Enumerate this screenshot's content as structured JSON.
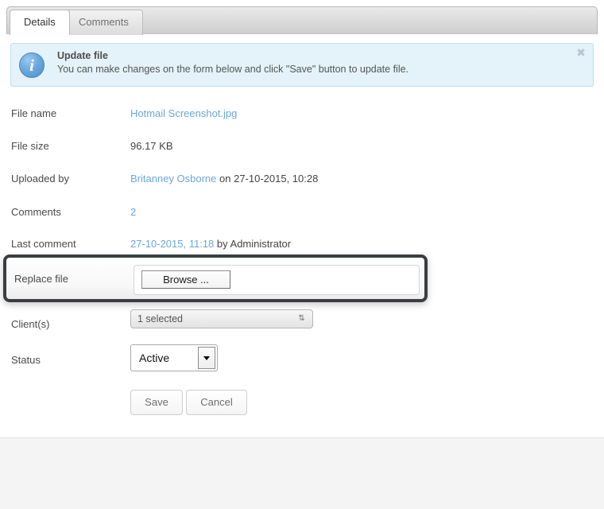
{
  "tabs": [
    {
      "label": "Details",
      "active": true
    },
    {
      "label": "Comments",
      "active": false
    }
  ],
  "banner": {
    "icon": "info-icon",
    "title": "Update file",
    "message": "You can make changes on the form below and click \"Save\" button to update file.",
    "close_label": "✖",
    "bg_color": "#e4f2f9",
    "border_color": "#bfdef0",
    "icon_color": "#6aa9dd"
  },
  "fields": {
    "file_name": {
      "label": "File name",
      "value": "Hotmail Screenshot.jpg",
      "is_link": true
    },
    "file_size": {
      "label": "File size",
      "value": "96.17 KB",
      "is_link": false
    },
    "uploaded_by": {
      "label": "Uploaded by",
      "link_text": "Britanney Osborne",
      "rest_text": " on 27-10-2015, 10:28"
    },
    "comments": {
      "label": "Comments",
      "value": "2",
      "is_link": true
    },
    "last_comment": {
      "label": "Last comment",
      "link_text": "27-10-2015, 11:18",
      "rest_text": " by Administrator"
    },
    "replace_file": {
      "label": "Replace file",
      "browse_label": "Browse ...",
      "highlight_color": "#3a3e42"
    },
    "clients": {
      "label": "Client(s)",
      "selected": "1 selected",
      "arrows_glyph": "⇅"
    },
    "status": {
      "label": "Status",
      "selected": "Active"
    }
  },
  "actions": {
    "save_label": "Save",
    "cancel_label": "Cancel"
  },
  "theme": {
    "link_color": "#6aa8dc",
    "text_color": "#444444",
    "page_bg": "#f4f4f4",
    "panel_bg": "#ffffff"
  }
}
